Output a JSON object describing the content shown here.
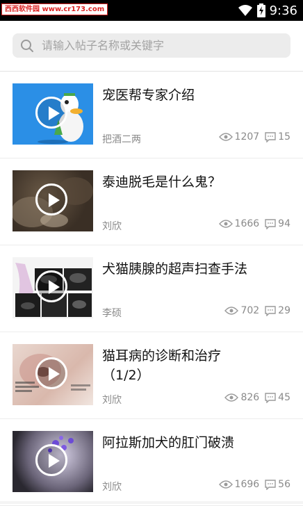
{
  "status_bar": {
    "time": "9:36",
    "watermark": "西西软件园",
    "watermark_url": "www.cr173.com"
  },
  "search": {
    "placeholder": "请输入帖子名称或关键字"
  },
  "posts": [
    {
      "title": "宠医帮专家介绍",
      "author": "把酒二两",
      "views": "1207",
      "comments": "15",
      "thumb": "cartoon-doctor-duck"
    },
    {
      "title": "泰迪脱毛是什么鬼？",
      "author": "刘欣",
      "views": "1666",
      "comments": "94",
      "thumb": "dog-fur-closeup"
    },
    {
      "title": "犬猫胰腺的超声扫查手法",
      "author": "李硕",
      "views": "702",
      "comments": "29",
      "thumb": "ultrasound-scans"
    },
    {
      "title": "猫耳病的诊断和治疗（1/2）",
      "author": "刘欣",
      "views": "826",
      "comments": "45",
      "thumb": "cat-ear-slide"
    },
    {
      "title": "阿拉斯加犬的肛门破溃",
      "author": "刘欣",
      "views": "1696",
      "comments": "56",
      "thumb": "microscope-view"
    }
  ],
  "colors": {
    "thumb1_bg": "#2b8fe6",
    "statusbar": "#000000",
    "search_bg": "#ececec",
    "meta_text": "#8a8a8a"
  }
}
